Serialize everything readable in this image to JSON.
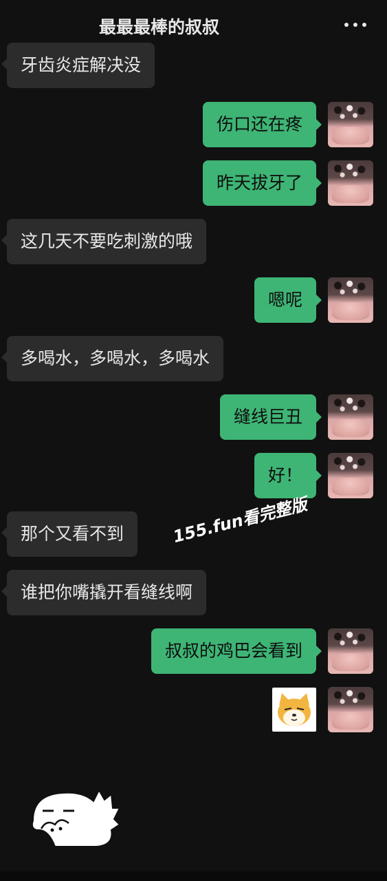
{
  "header": {
    "title": "最最最棒的叔叔",
    "more_icon": "more-dots-icon"
  },
  "messages": [
    {
      "side": "in",
      "text": "牙齿炎症解决没"
    },
    {
      "side": "out",
      "text": "伤口还在疼"
    },
    {
      "side": "out",
      "text": "昨天拔牙了"
    },
    {
      "side": "in",
      "text": "这几天不要吃刺激的哦"
    },
    {
      "side": "out",
      "text": "嗯呢"
    },
    {
      "side": "in",
      "text": "多喝水，多喝水，多喝水"
    },
    {
      "side": "out",
      "text": "缝线巨丑"
    },
    {
      "side": "out",
      "text": "好！"
    },
    {
      "side": "in",
      "text": "那个又看不到"
    },
    {
      "side": "in",
      "text": "谁把你嘴撬开看缝线啊"
    },
    {
      "side": "out",
      "text": "叔叔的鸡巴会看到"
    }
  ],
  "stickers": {
    "dog": "dog-face-sticker",
    "dino": "dinosaur-sticker"
  },
  "watermark": "155.fun看完整版",
  "colors": {
    "background": "#111111",
    "incoming_bubble": "#2c2c2c",
    "outgoing_bubble": "#3eb575"
  }
}
